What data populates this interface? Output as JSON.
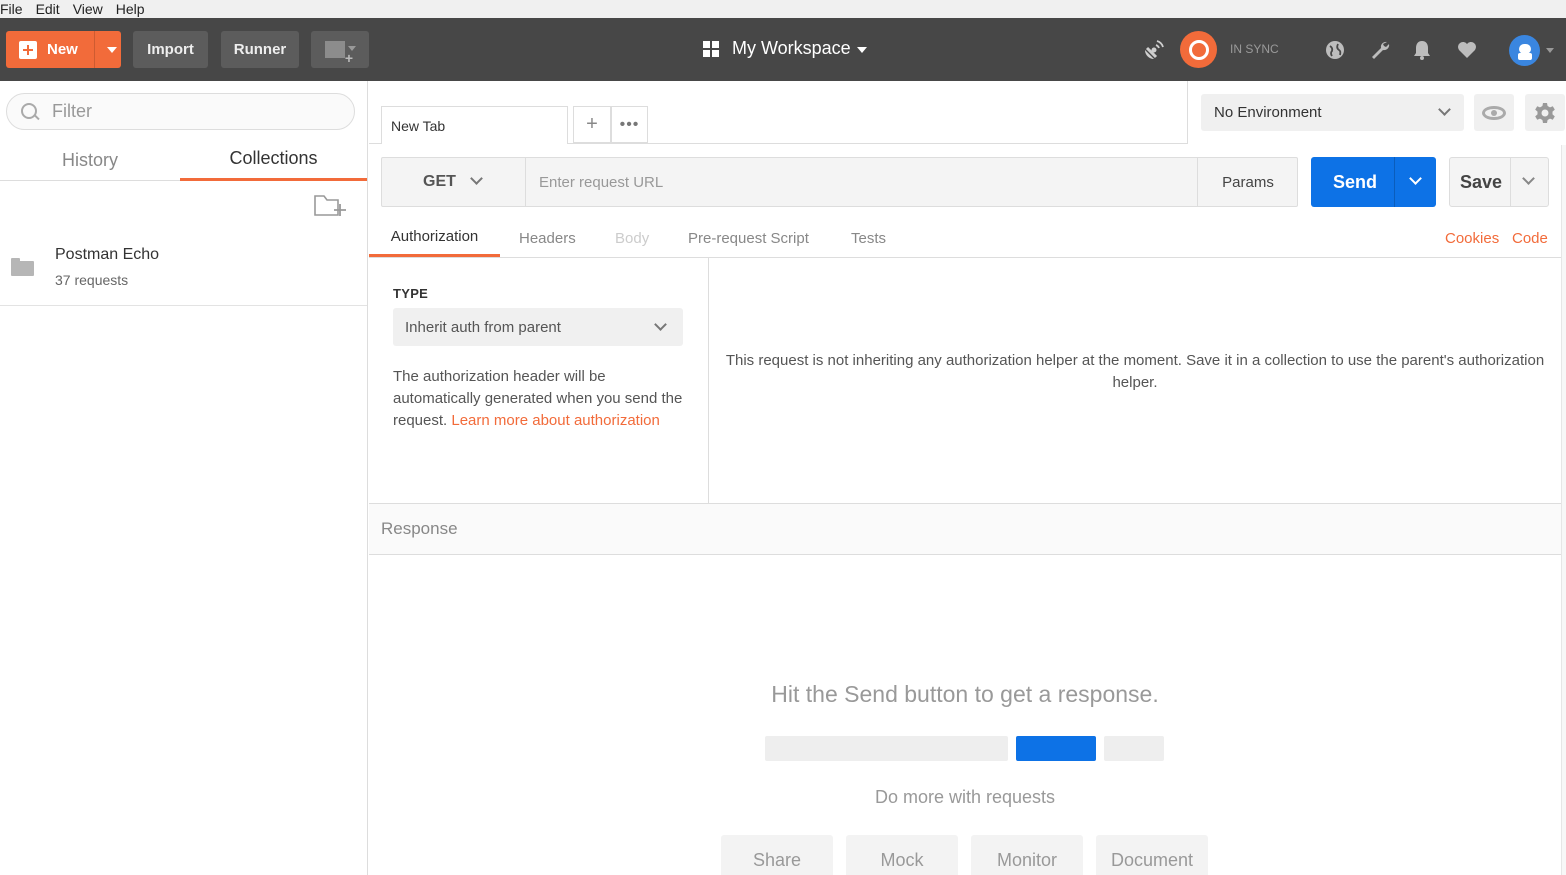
{
  "menu": [
    "File",
    "Edit",
    "View",
    "Help"
  ],
  "header": {
    "new_label": "New",
    "import_label": "Import",
    "runner_label": "Runner",
    "workspace_label": "My Workspace",
    "sync_status": "IN SYNC",
    "icons": [
      "satellite-icon",
      "sync-icon",
      "globe-icon",
      "wrench-icon",
      "bell-icon",
      "heart-icon",
      "avatar-icon"
    ],
    "accent_color": "#f26b3a",
    "bg_color": "#474747"
  },
  "sidebar": {
    "filter_placeholder": "Filter",
    "tabs": {
      "history": "History",
      "collections": "Collections"
    },
    "active_tab": "Collections",
    "collections": [
      {
        "name": "Postman Echo",
        "count": "37 requests"
      }
    ]
  },
  "request": {
    "tab_label": "New Tab",
    "tab_more": "•••",
    "tab_plus": "+",
    "environment": "No Environment",
    "method": "GET",
    "url_placeholder": "Enter request URL",
    "params_label": "Params",
    "send_label": "Send",
    "save_label": "Save",
    "send_color": "#0d72e6",
    "tabs": {
      "authorization": "Authorization",
      "headers": "Headers",
      "body": "Body",
      "prerequest": "Pre-request Script",
      "tests": "Tests",
      "cookies": "Cookies",
      "code": "Code"
    },
    "active_tab": "Authorization"
  },
  "auth": {
    "type_label": "TYPE",
    "type_value": "Inherit auth from parent",
    "description": "The authorization header will be automatically generated when you send the request. ",
    "learn_more": "Learn more about authorization",
    "message": "This request is not inheriting any authorization helper at the moment. Save it in a collection to use the parent's authorization helper."
  },
  "response": {
    "label": "Response",
    "hint": "Hit the Send button to get a response.",
    "do_more": "Do more with requests",
    "actions": {
      "share": "Share",
      "mock": "Mock",
      "monitor": "Monitor",
      "document": "Document"
    }
  }
}
